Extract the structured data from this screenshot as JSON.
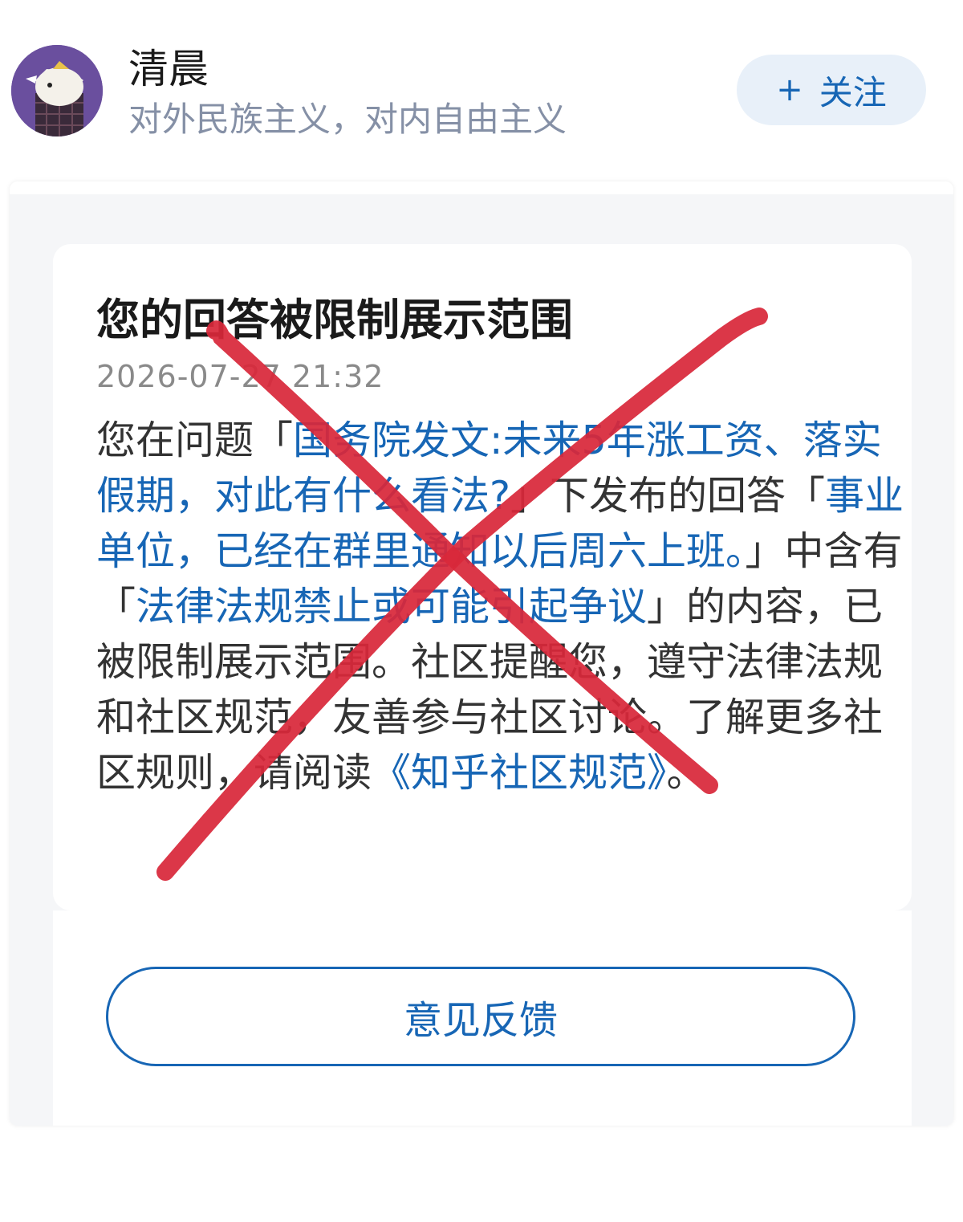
{
  "header": {
    "user_name": "清晨",
    "user_bio": "对外民族主义，对内自由主义",
    "follow_plus": "+",
    "follow_label": "关注"
  },
  "notice": {
    "title": "您的回答被限制展示范围",
    "timestamp": "2026-07-27  21:32",
    "body": {
      "part1": "您在问题「",
      "question_link": "国务院发文:未来5年涨工资、落实假期，对此有什么看法?",
      "part2": "」下发布的回答「",
      "answer_link": "事业单位，已经在群里通知以后周六上班。",
      "part3": "」中含有「",
      "reason_link": "法律法规禁止或可能引起争议",
      "part4": "」的内容，已被限制展示范围。社区提醒您，遵守法律法规和社区规范，友善参与社区讨论。了解更多社区规则，请阅读",
      "rules_link": "《知乎社区规范》",
      "part5": "。"
    },
    "feedback_label": "意见反馈"
  },
  "colors": {
    "link": "#1766b5",
    "follow_bg": "#e8f0f9",
    "bio": "#8590a6",
    "overlay_x": "#d8283a"
  },
  "icons": {
    "avatar": "cartoon-avatar",
    "overlay": "red-x-cross-mark"
  }
}
